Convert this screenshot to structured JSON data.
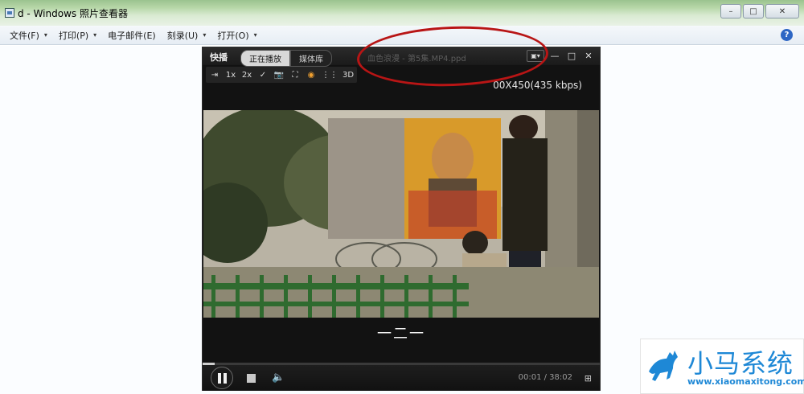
{
  "window": {
    "title": "d - Windows 照片查看器",
    "controls": {
      "minimize": "–",
      "maximize": "□",
      "close": "✕"
    }
  },
  "menubar": {
    "items": [
      {
        "label": "文件(F)",
        "caret": "▾"
      },
      {
        "label": "打印(P)",
        "caret": "▾"
      },
      {
        "label": "电子邮件(E)",
        "caret": ""
      },
      {
        "label": "刻录(U)",
        "caret": "▾"
      },
      {
        "label": "打开(O)",
        "caret": "▾"
      }
    ],
    "help": "?"
  },
  "player": {
    "logo": "快播",
    "tabs": {
      "now_playing": "正在播放",
      "library": "媒体库"
    },
    "filename": "血色浪漫 - 第5集.MP4.ppd",
    "controls": {
      "skin": "▣▾",
      "minimize": "—",
      "maximize": "□",
      "close": "✕"
    },
    "toolbar": [
      "⇥",
      "1x",
      "2x",
      "✓",
      "📷",
      "⛶",
      "◉",
      "⋮⋮",
      "3D"
    ],
    "resolution_info": "00X450(435 kbps)",
    "subtitle": "一二一",
    "progress": 0.03,
    "time": "00:01 / 38:02",
    "list_icon": "⊞"
  },
  "watermark": {
    "title": "小马系统",
    "url": "www.xiaomaxitong.com"
  },
  "colors": {
    "annotation_circle": "#b81515",
    "watermark_blue": "#1e88d6"
  }
}
